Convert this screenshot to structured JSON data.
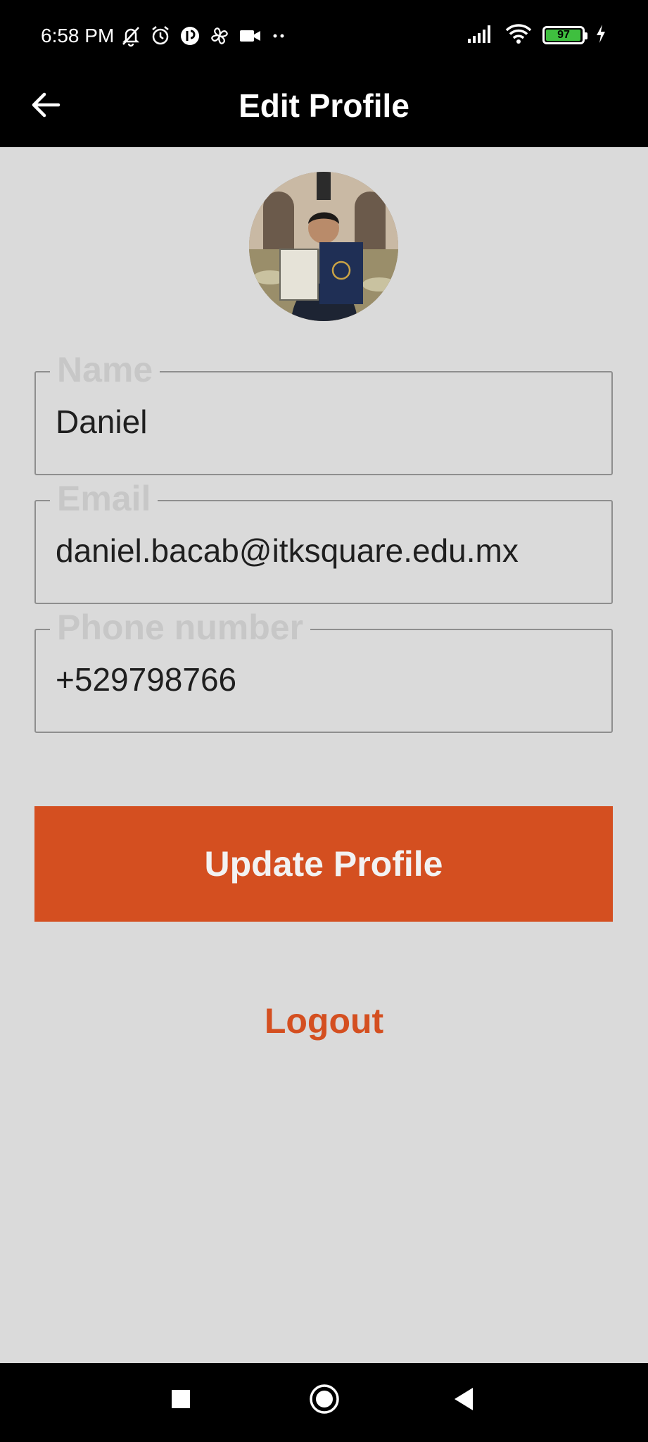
{
  "status_bar": {
    "time": "6:58 PM",
    "battery_level": "97",
    "battery_fill": 0.97,
    "icons": [
      "mute-icon",
      "alarm-icon",
      "app-notification-icon",
      "pinwheel-icon",
      "video-icon",
      "more-dots-icon",
      "signal-icon",
      "wifi-icon",
      "battery-icon",
      "charging-icon"
    ]
  },
  "app_bar": {
    "title": "Edit Profile",
    "back_icon": "back-arrow-icon"
  },
  "profile": {
    "avatar": "profile-photo"
  },
  "form": {
    "name": {
      "label": "Name",
      "value": "Daniel"
    },
    "email": {
      "label": "Email",
      "value": "daniel.bacab@itksquare.edu.mx"
    },
    "phone": {
      "label": "Phone number",
      "value": "+529798766"
    }
  },
  "actions": {
    "update_label": "Update Profile",
    "logout_label": "Logout"
  },
  "colors": {
    "accent": "#d44f20",
    "background": "#dadada",
    "bar": "#000000"
  },
  "nav_bar": {
    "icons": [
      "recents-square-icon",
      "home-circle-icon",
      "back-triangle-icon"
    ]
  }
}
